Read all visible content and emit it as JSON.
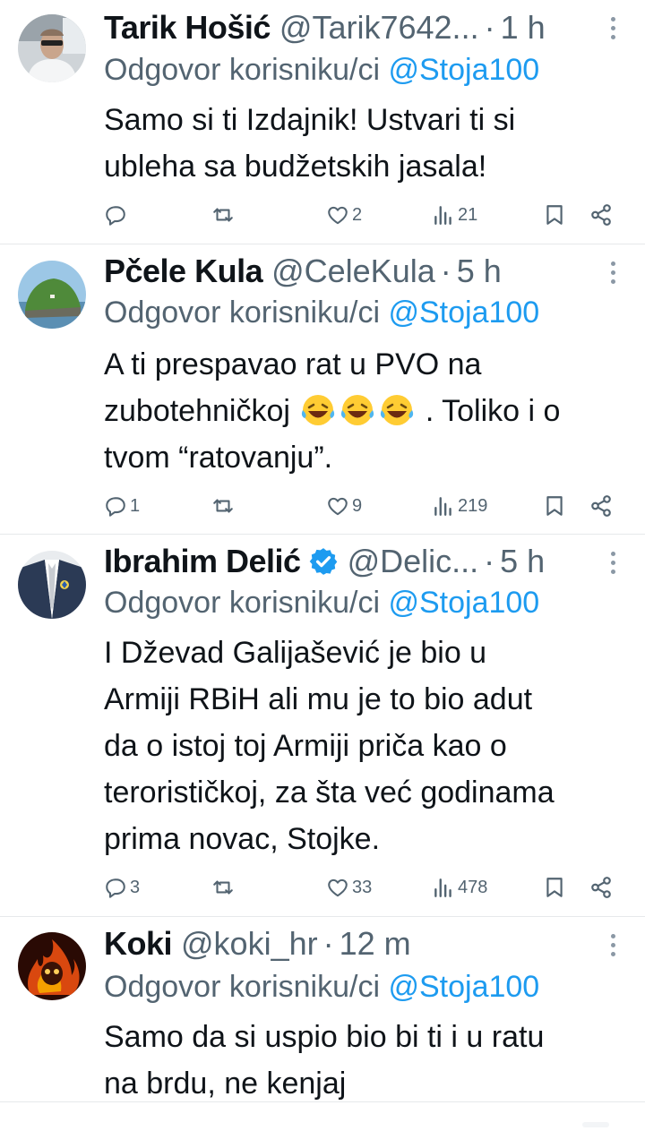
{
  "tweets": [
    {
      "name": "Tarik Hošić",
      "handle": "@Tarik7642...",
      "time": "1 h",
      "reply_prefix": "Odgovor korisniku/ci",
      "reply_to": "@Stoja100",
      "text_lines": [
        "Samo si ti Izdajnik! Ustvari ti si",
        "ubleha sa budžetskih jasala!"
      ],
      "replies": "",
      "retweets": "",
      "likes": "2",
      "views": "21",
      "avatar_icon": "man-with-glasses-in-car-avatar"
    },
    {
      "name": "Pčele Kula",
      "handle": "@CeleKula",
      "time": "5 h",
      "reply_prefix": "Odgovor korisniku/ci",
      "reply_to": "@Stoja100",
      "text_lines": [
        "A ti prespavao rat u PVO na",
        "zubotehničkoj",
        ". Toliko i o",
        "tvom “ratovanju”."
      ],
      "emoji": "😂😂😂",
      "replies": "1",
      "retweets": "",
      "likes": "9",
      "views": "219",
      "avatar_icon": "green-island-cliff-avatar"
    },
    {
      "name": "Ibrahim Delić",
      "handle": "@Delic...",
      "time": "5 h",
      "reply_prefix": "Odgovor korisniku/ci",
      "reply_to": "@Stoja100",
      "text_lines": [
        "I Dževad Galijašević je bio u",
        "Armiji RBiH ali mu je to bio adut",
        "da o istoj toj Armiji priča kao o",
        "terorističkoj, za šta već godinama",
        "prima novac, Stojke."
      ],
      "replies": "3",
      "retweets": "",
      "likes": "33",
      "views": "478",
      "verified": true,
      "avatar_icon": "suit-with-lily-badge-avatar"
    },
    {
      "name": "Koki",
      "handle": "@koki_hr",
      "time": "12 m",
      "reply_prefix": "Odgovor korisniku/ci",
      "reply_to": "@Stoja100",
      "text_lines": [
        "Samo da si uspio bio bi ti i u ratu",
        "na brdu, ne kenjaj"
      ],
      "avatar_icon": "fire-skull-avatar"
    }
  ],
  "colors": {
    "text": "#0f1419",
    "secondary": "#536471",
    "mention": "#1d9bf0",
    "verified": "#1d9bf0",
    "separator": "#e6e9eb"
  },
  "icons": {
    "reply": "reply-icon",
    "retweet": "retweet-icon",
    "like": "heart-icon",
    "views": "views-chart-icon",
    "bookmark": "bookmark-icon",
    "share": "share-icon",
    "more": "more-vertical-icon"
  }
}
